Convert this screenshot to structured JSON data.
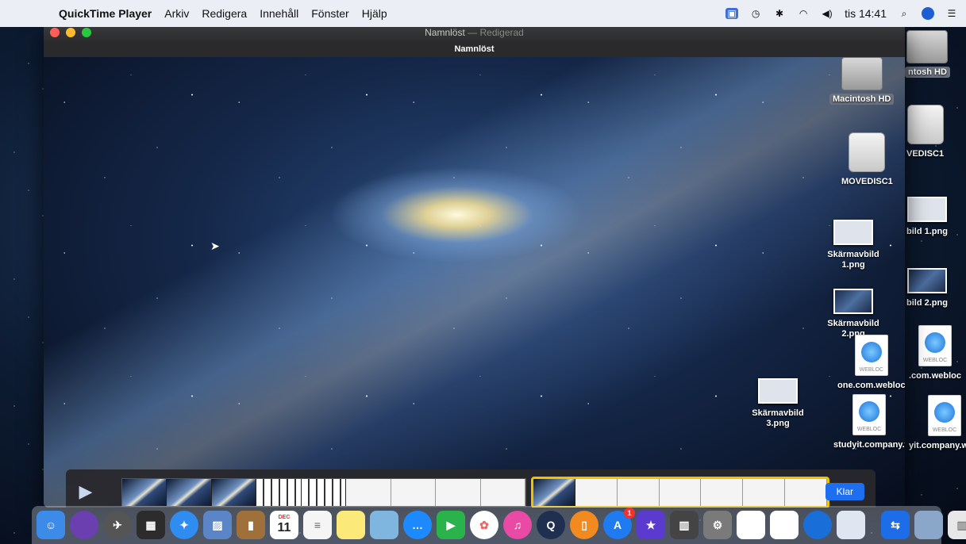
{
  "menubar": {
    "apple_icon": "apple-icon",
    "app_name": "QuickTime Player",
    "items": [
      "Arkiv",
      "Redigera",
      "Innehåll",
      "Fönster",
      "Hjälp"
    ],
    "clock": "tis 14:41"
  },
  "window": {
    "title": "Namnlöst",
    "title_suffix": " — Redigerad",
    "subtitle": "Namnlöst"
  },
  "trim": {
    "done_label": "Klar"
  },
  "desktop": {
    "icons": [
      {
        "label": "Macintosh HD"
      },
      {
        "label": "MOVEDISC1"
      },
      {
        "label": "Skärmavbild 1.png"
      },
      {
        "label": "Skärmavbild 2.png"
      },
      {
        "label": "one.com.webloc"
      },
      {
        "label": "Skärmavbild 3.png"
      },
      {
        "label": "studyit.company.webloc"
      }
    ],
    "partial_labels": [
      "ntosh HD",
      "VEDISC1",
      "bild 1.png",
      "bild 2.png",
      ".com.webloc",
      "yit.company.webloc"
    ],
    "webloc_text": "WEBLOC"
  },
  "dock": {
    "calendar_month": "DEC",
    "calendar_day": "11",
    "badge": "1"
  },
  "colors": {
    "accent": "#1e6ff0",
    "trim_border": "#f2c200"
  }
}
